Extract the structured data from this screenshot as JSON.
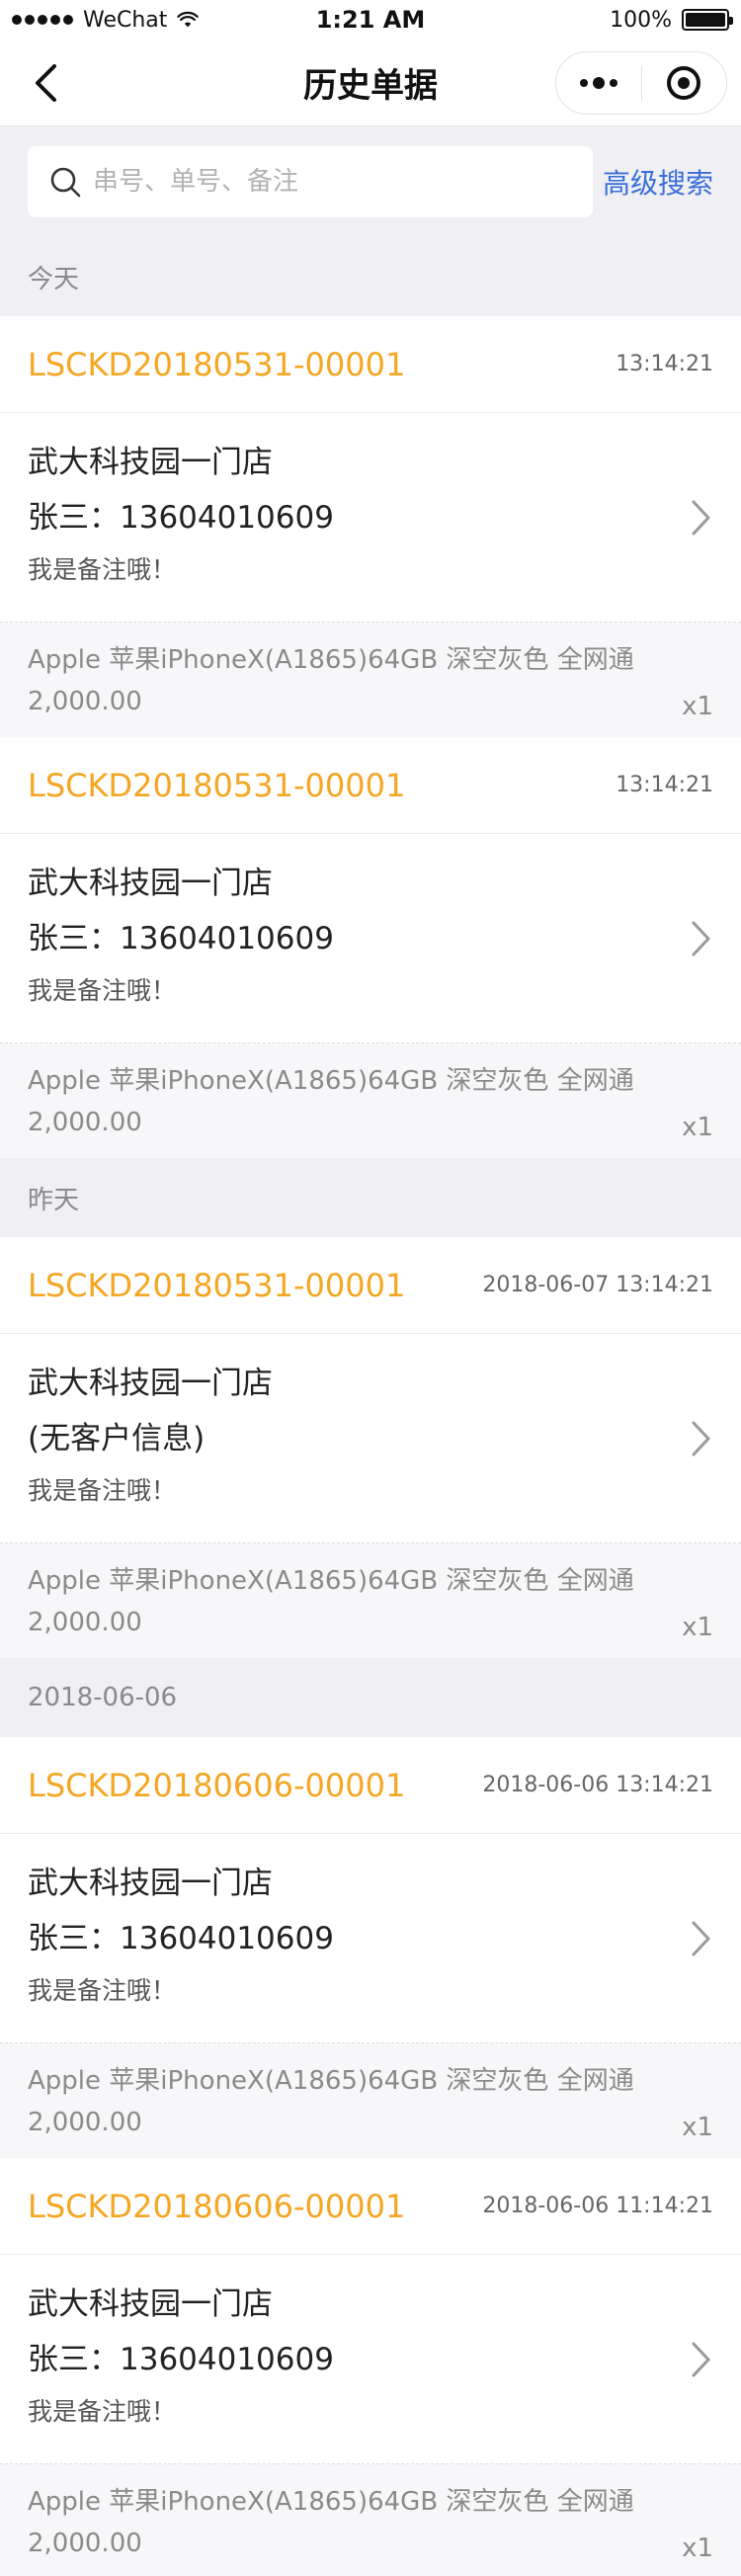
{
  "status_bar": {
    "carrier": "WeChat",
    "time": "1:21 AM",
    "battery": "100%"
  },
  "nav": {
    "title": "历史单据"
  },
  "search": {
    "placeholder": "串号、单号、备注",
    "value": "",
    "advanced_label": "高级搜索"
  },
  "groups": [
    {
      "label": "今天",
      "orders": [
        {
          "no": "LSCKD20180531-00001",
          "time": "13:14:21",
          "store": "武大科技园一门店",
          "customer": "张三：13604010609",
          "note": "我是备注哦！",
          "goods": "Apple 苹果iPhoneX(A1865)64GB 深空灰色 全网通",
          "price": "2,000.00",
          "qty": "x1"
        },
        {
          "no": "LSCKD20180531-00001",
          "time": "13:14:21",
          "store": "武大科技园一门店",
          "customer": "张三：13604010609",
          "note": "我是备注哦！",
          "goods": "Apple 苹果iPhoneX(A1865)64GB 深空灰色 全网通",
          "price": "2,000.00",
          "qty": "x1"
        }
      ]
    },
    {
      "label": "昨天",
      "orders": [
        {
          "no": "LSCKD20180531-00001",
          "time": "2018-06-07  13:14:21",
          "store": "武大科技园一门店",
          "customer": "(无客户信息)",
          "note": "我是备注哦！",
          "goods": "Apple 苹果iPhoneX(A1865)64GB 深空灰色 全网通",
          "price": "2,000.00",
          "qty": "x1"
        }
      ]
    },
    {
      "label": "2018-06-06",
      "orders": [
        {
          "no": "LSCKD20180606-00001",
          "time": "2018-06-06  13:14:21",
          "store": "武大科技园一门店",
          "customer": "张三：13604010609",
          "note": "我是备注哦！",
          "goods": "Apple 苹果iPhoneX(A1865)64GB 深空灰色 全网通",
          "price": "2,000.00",
          "qty": "x1"
        },
        {
          "no": "LSCKD20180606-00001",
          "time": "2018-06-06  11:14:21",
          "store": "武大科技园一门店",
          "customer": "张三：13604010609",
          "note": "我是备注哦！",
          "goods": "Apple 苹果iPhoneX(A1865)64GB 深空灰色 全网通",
          "price": "2,000.00",
          "qty": "x1"
        }
      ]
    }
  ],
  "colors": {
    "order_no": "#f5a623",
    "link": "#3a6fd8",
    "section_bg": "#efeff4"
  },
  "icons": {
    "back": "chevron-left-icon",
    "more": "more-dots-icon",
    "close_target": "target-icon",
    "search": "search-icon",
    "chevron": "chevron-right-icon"
  }
}
